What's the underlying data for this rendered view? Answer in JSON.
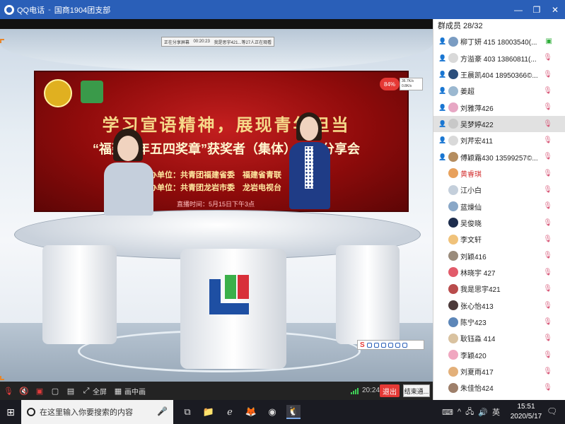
{
  "window": {
    "app_name": "QQ电话",
    "separator": "-",
    "group_name": "国商1904团支部",
    "controls": {
      "minimize": "—",
      "restore": "❐",
      "close": "✕"
    }
  },
  "share_banner": {
    "status": "正在分享屏幕",
    "duration": "00:20:23",
    "message": "我是思宇421...等27人正在观看"
  },
  "broadcast": {
    "headline": "学习宣语精神，展现青年担当",
    "subline": "“福建青年五四奖章”获奖者（集体）事迹分享会",
    "org_line1": "主办单位：共青团福建省委　福建省青联",
    "org_line2": "承办单位：共青团龙岩市委　龙岩电视台",
    "time_line": "直播时间：5月15日下午3点"
  },
  "overlay": {
    "cpu_percent": "84%",
    "net_up": "36.7K/s",
    "net_down": "0.8K/s"
  },
  "controls": {
    "mute_mic_icon": "mic-off-icon",
    "speaker_icon": "speaker-muted-icon",
    "camera_icon": "camera-off-icon",
    "share_screen_icon": "screen-share-icon",
    "share_video_icon": "share-video-icon",
    "fullscreen_label": "全屏",
    "pip_label": "画中画",
    "call_time": "20:24",
    "quit_label": "退出",
    "end_label": "结束通..."
  },
  "members": {
    "header": "群成员 28/32",
    "list": [
      {
        "name": "柳丁妍 415  18003540(...",
        "person": true,
        "mic": "green",
        "av": "#7a9cc2",
        "selected": false
      },
      {
        "name": "方溢豪 403  13860811(...",
        "person": true,
        "mic": "muted",
        "av": "#d9d9d9",
        "selected": false
      },
      {
        "name": "王晨凯404  18950366©...",
        "person": true,
        "mic": "muted",
        "av": "#2c4f7c",
        "selected": false
      },
      {
        "name": "姜超",
        "person": true,
        "mic": "muted",
        "av": "#9bb8d0",
        "selected": false
      },
      {
        "name": "刘雅萍426",
        "person": true,
        "mic": "muted",
        "av": "#e7a7c4",
        "selected": false
      },
      {
        "name": "吴梦婷422",
        "person": true,
        "mic": "muted",
        "av": "#c8c8c8",
        "selected": true
      },
      {
        "name": "刘芹宏411",
        "person": true,
        "mic": "muted",
        "av": "#d9d9d9",
        "selected": false
      },
      {
        "name": "傅颖霜430  13599257©...",
        "person": true,
        "mic": "muted",
        "av": "#b58d5f",
        "selected": false
      },
      {
        "name": "黄睿琪",
        "person": false,
        "mic": "muted",
        "av": "#e8a15c",
        "red": true,
        "selected": false
      },
      {
        "name": "江小白",
        "person": false,
        "mic": "muted",
        "av": "#c4cfdb",
        "selected": false
      },
      {
        "name": "蓝燥仙",
        "person": false,
        "mic": "muted",
        "av": "#89a7c7",
        "selected": false
      },
      {
        "name": "吴俊晓",
        "person": false,
        "mic": "muted",
        "av": "#1d2d4d",
        "selected": false
      },
      {
        "name": "李文轩",
        "person": false,
        "mic": "muted",
        "av": "#f0c27a",
        "selected": false
      },
      {
        "name": "刘颖416",
        "person": false,
        "mic": "muted",
        "av": "#9a8b7b",
        "selected": false
      },
      {
        "name": "林晓宇 427",
        "person": false,
        "mic": "muted",
        "av": "#e25b6a",
        "selected": false
      },
      {
        "name": "我是思宇421",
        "person": false,
        "mic": "muted",
        "av": "#b94c4c",
        "selected": false
      },
      {
        "name": "张心怡413",
        "person": false,
        "mic": "muted",
        "av": "#4c3a3a",
        "selected": false
      },
      {
        "name": "陈宁423",
        "person": false,
        "mic": "muted",
        "av": "#5c86b8",
        "selected": false
      },
      {
        "name": "耿钰淼 414",
        "person": false,
        "mic": "muted",
        "av": "#d9c2a0",
        "selected": false
      },
      {
        "name": "李颖420",
        "person": false,
        "mic": "muted",
        "av": "#f0a7c0",
        "selected": false
      },
      {
        "name": "刘夏雨417",
        "person": false,
        "mic": "muted",
        "av": "#e3b07a",
        "selected": false
      },
      {
        "name": "朱佳怡424",
        "person": false,
        "mic": "muted",
        "av": "#9e7f6a",
        "selected": false
      }
    ]
  },
  "taskbar": {
    "search_placeholder": "在这里输入你要搜索的内容",
    "time": "15:51",
    "date": "2020/5/17"
  }
}
